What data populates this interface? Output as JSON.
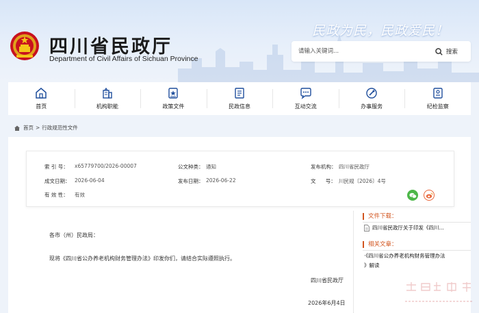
{
  "header": {
    "title": "四川省民政厅",
    "subtitle": "Department of Civil Affairs of Sichuan Province",
    "slogan": "民政为民，民政爱民！",
    "search": {
      "placeholder": "请输入关键词...",
      "button_label": "搜索"
    }
  },
  "nav": [
    {
      "label": "首页",
      "icon": "home-icon"
    },
    {
      "label": "机构职能",
      "icon": "building-icon"
    },
    {
      "label": "政策文件",
      "icon": "document-icon"
    },
    {
      "label": "民政信息",
      "icon": "info-icon"
    },
    {
      "label": "互动交流",
      "icon": "chat-icon"
    },
    {
      "label": "办事服务",
      "icon": "service-icon"
    },
    {
      "label": "纪检监察",
      "icon": "inspection-icon"
    }
  ],
  "breadcrumb": {
    "home": "首页",
    "separator": ">",
    "current": "行政规范性文件"
  },
  "meta": {
    "index_label": "索 引 号：",
    "index_value": "x65779700/2026-00007",
    "type_label": "公文种类：",
    "type_value": "通知",
    "issuer_label": "发布机构：",
    "issuer_value": "四川省民政厅",
    "formed_label": "成文日期：",
    "formed_value": "2026-06-04",
    "published_label": "发布日期：",
    "published_value": "2026-06-22",
    "docno_label": "文      号：",
    "docno_value": "川民规〔2026〕4号",
    "validity_label": "有 效 性：",
    "validity_value": "有效"
  },
  "share": {
    "wechat_icon": "wechat-icon",
    "weibo_icon": "weibo-icon",
    "wechat_color": "#4cb748",
    "weibo_color": "#e8663a"
  },
  "article": {
    "salutation": "各市（州）民政局：",
    "paragraph": "现将《四川省公办养老机构财务管理办法》印发你们，请结合实际遵照执行。",
    "signature": "四川省民政厅",
    "date": "2026年6月4日"
  },
  "sidebar": {
    "downloads_title": "文件下载：",
    "download_item": "四川省民政厅关于印发《四川...",
    "related_title": "相关文章：",
    "related_line1": "·《四川省公办养老机构财务管理办法",
    "related_line2": "》解读"
  },
  "colors": {
    "accent": "#d2541e",
    "nav_bg": "#ffffff",
    "page_bg": "#eef3fa"
  }
}
